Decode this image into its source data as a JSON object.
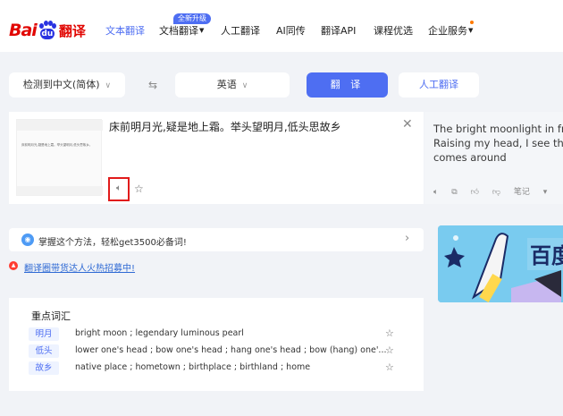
{
  "header": {
    "logo_text_bai": "Bai",
    "logo_text_du": "du",
    "logo_text_fanyi": "翻译",
    "nav": [
      "文本翻译",
      "文档翻译",
      "人工翻译",
      "AI同传",
      "翻译API",
      "课程优选",
      "企业服务"
    ],
    "badge": "全新升级",
    "accent_color": "#4e6ef2",
    "brand_red": "#e10602"
  },
  "lang": {
    "source": "检测到中文(简体)",
    "swap_icon": "swap-icon",
    "target": "英语",
    "translate_button": "翻 译",
    "human_button": "人工翻译"
  },
  "input": {
    "text": "床前明月光,疑是地上霜。举头望明月,低头思故乡",
    "thumb_preview": "床前明月光,疑是地上霜。举头望明月,低头思故乡。"
  },
  "output": {
    "lines": [
      "The bright moonlight in fron",
      "Raising my head, I see the",
      "comes around"
    ],
    "note_label": "笔记"
  },
  "tip": {
    "text": "掌握这个方法，轻松get3500必备词!"
  },
  "recruit": {
    "text": "翻译圈带货达人火热招募中!"
  },
  "banner": {
    "text": "百度"
  },
  "vocab": {
    "title": "重点词汇",
    "items": [
      {
        "word": "明月",
        "def": "bright moon ; legendary luminous pearl"
      },
      {
        "word": "低头",
        "def": "lower one's head ; bow one's head ; hang one's head ; bow (hang) one'..."
      },
      {
        "word": "故乡",
        "def": "native place ; hometown ; birthplace ; birthland ; home"
      }
    ]
  }
}
